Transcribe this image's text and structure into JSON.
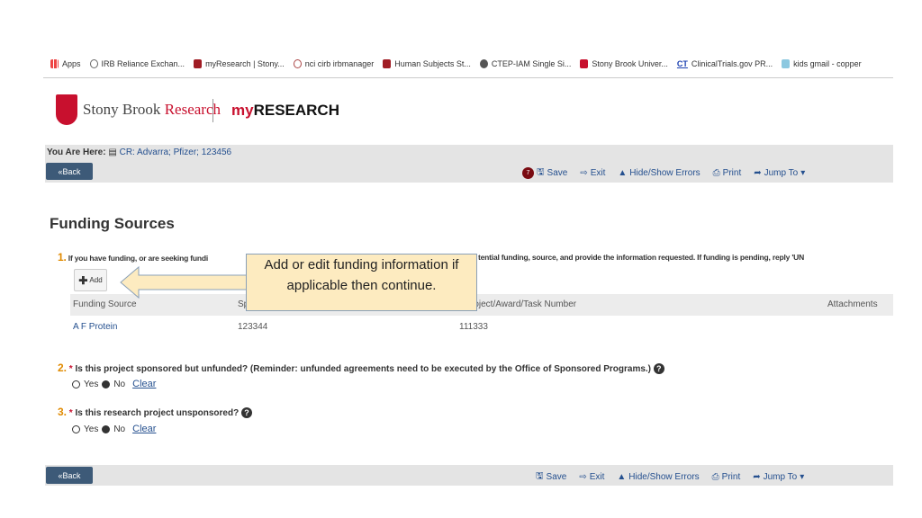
{
  "bookmarks": [
    "Apps",
    "IRB Reliance Exchan...",
    "myResearch | Stony...",
    "nci cirb irbmanager",
    "Human Subjects St...",
    "CTEP-IAM Single Si...",
    "Stony Brook Univer...",
    "ClinicalTrials.gov PR...",
    "kids gmail - copper"
  ],
  "logo": {
    "brand": "Stony Brook",
    "brand_accent": "Research",
    "app_prefix": "my",
    "app_name": "RESEARCH"
  },
  "breadcrumb": {
    "label": "You Are Here:",
    "path": "CR: Advarra; Pfizer; 123456"
  },
  "toolbar": {
    "back": "«Back",
    "badge": "7",
    "save": "Save",
    "exit": "Exit",
    "errors": "Hide/Show Errors",
    "print": "Print",
    "jump": "Jump To"
  },
  "page_title": "Funding Sources",
  "q1": {
    "num": "1.",
    "text_start": "If you have funding, or are seeking fundi",
    "text_end": "tential funding, source, and provide the information requested.  If funding is pending, reply 'UN",
    "add": "Add"
  },
  "table": {
    "headers": [
      "Funding Source",
      "Sp",
      "e Project/Award/Task Number",
      "Attachments"
    ],
    "rows": [
      [
        "A F Protein",
        "123344",
        "111333",
        ""
      ]
    ]
  },
  "q2": {
    "num": "2.",
    "text": "Is this project sponsored but unfunded? (Reminder: unfunded agreements need to be executed by the Office of Sponsored Programs.)",
    "yes": "Yes",
    "no": "No",
    "clear": "Clear",
    "selected": "No"
  },
  "q3": {
    "num": "3.",
    "text": "Is this research project unsponsored?",
    "yes": "Yes",
    "no": "No",
    "clear": "Clear",
    "selected": "No"
  },
  "callout": "Add or edit funding information if applicable then continue.",
  "colors": {
    "brand": "#c8102e",
    "link": "#25508f",
    "callout": "#fdebc0"
  }
}
